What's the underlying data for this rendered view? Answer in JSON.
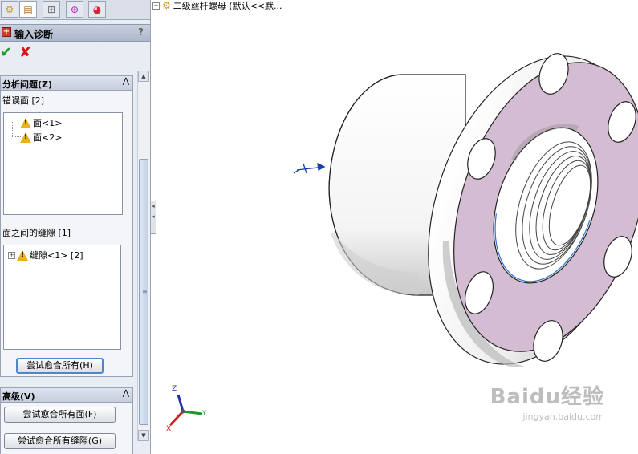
{
  "tabs": [
    {
      "icon": "feature-tree-icon"
    },
    {
      "icon": "property-manager-icon"
    },
    {
      "icon": "configuration-manager-icon"
    },
    {
      "icon": "dimxpert-icon"
    },
    {
      "icon": "display-manager-icon"
    }
  ],
  "panel": {
    "title": "输入诊断",
    "help": "?"
  },
  "analyze": {
    "header": "分析问题(Z)",
    "faulty_faces_label": "错误面 [2]",
    "faces": [
      "面<1>",
      "面<2>"
    ],
    "gaps_label": "面之间的缝隙 [1]",
    "gaps": [
      "缝隙<1> [2]"
    ],
    "heal_all_button": "尝试愈合所有(H)"
  },
  "advanced": {
    "header": "高级(V)",
    "heal_faces_button": "尝试愈合所有面(F)",
    "heal_gaps_button": "尝试愈合所有缝隙(G)"
  },
  "feature_tree": {
    "root_label": "二级丝杆螺母 (默认<<默..."
  },
  "triad": {
    "x": "X",
    "y": "Y",
    "z": "Z"
  },
  "watermark": {
    "brand": "Baidu经验",
    "url": "jingyan.baidu.com"
  },
  "colors": {
    "face_highlight": "#d4bcd2",
    "ok_green": "#1e9c2a",
    "cancel_red": "#dd1111"
  }
}
